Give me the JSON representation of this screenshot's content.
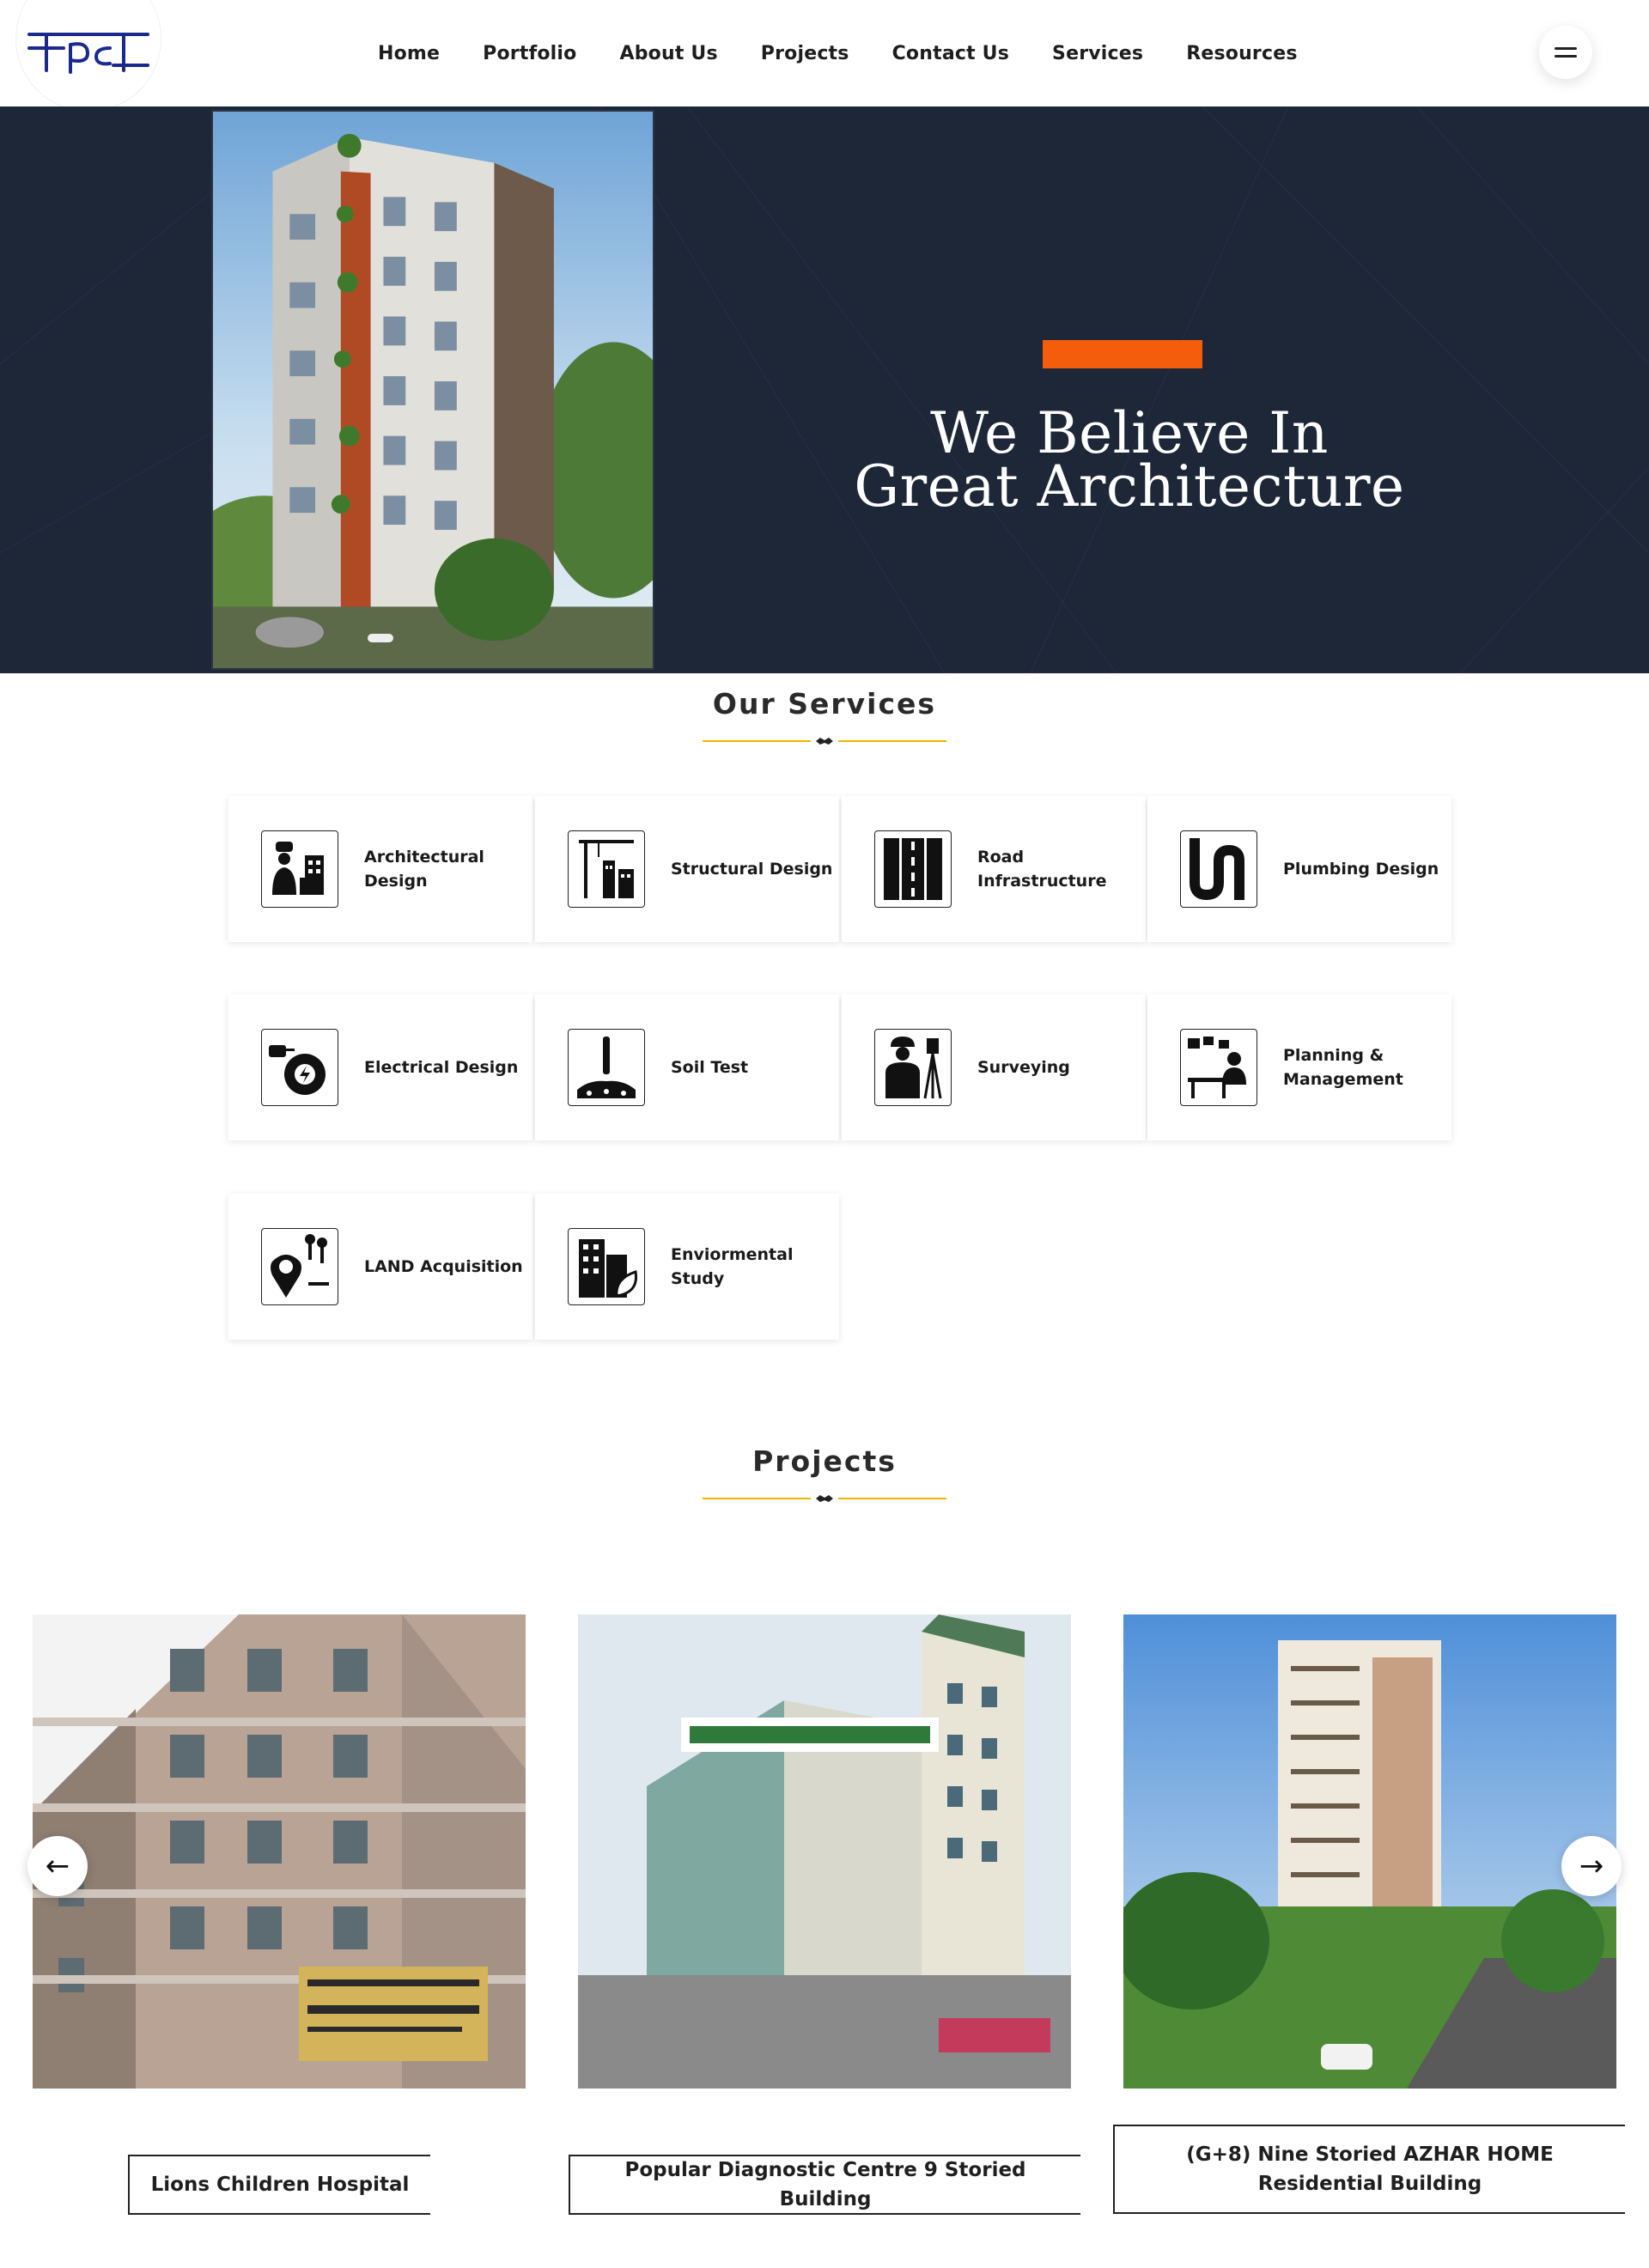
{
  "header": {
    "logo_text": "Fpc",
    "nav": [
      "Home",
      "Portfolio",
      "About Us",
      "Projects",
      "Contact Us",
      "Services",
      "Resources"
    ],
    "menu_icon": "hamburger-icon"
  },
  "hero": {
    "title_line1": "We Believe In",
    "title_line2": "Great Architecture",
    "accent_color": "#f45d0c",
    "background_color": "#1d2738"
  },
  "services": {
    "title": "Our Services",
    "items": [
      {
        "label": "Architectural Design",
        "icon": "architect-icon"
      },
      {
        "label": "Structural Design",
        "icon": "structure-crane-icon"
      },
      {
        "label": "Road Infrastructure",
        "icon": "road-icon"
      },
      {
        "label": "Plumbing Design",
        "icon": "pipe-icon"
      },
      {
        "label": "Electrical Design",
        "icon": "electric-plug-gear-icon"
      },
      {
        "label": "Soil Test",
        "icon": "soil-probe-icon"
      },
      {
        "label": "Surveying",
        "icon": "surveyor-icon"
      },
      {
        "label": "Planning & Management",
        "icon": "planning-desk-icon"
      },
      {
        "label": "LAND Acquisition",
        "icon": "land-location-icon"
      },
      {
        "label": "Enviormental Study",
        "icon": "green-building-icon"
      }
    ]
  },
  "projects": {
    "title": "Projects",
    "items": [
      {
        "caption": "Lions Children Hospital"
      },
      {
        "caption": "Popular Diagnostic Centre 9 Storied Building"
      },
      {
        "caption": "(G+8) Nine Storied AZHAR HOME Residential Building"
      }
    ],
    "prev_icon": "arrow-left-icon",
    "next_icon": "arrow-right-icon",
    "divider_color": "#f0b400"
  }
}
